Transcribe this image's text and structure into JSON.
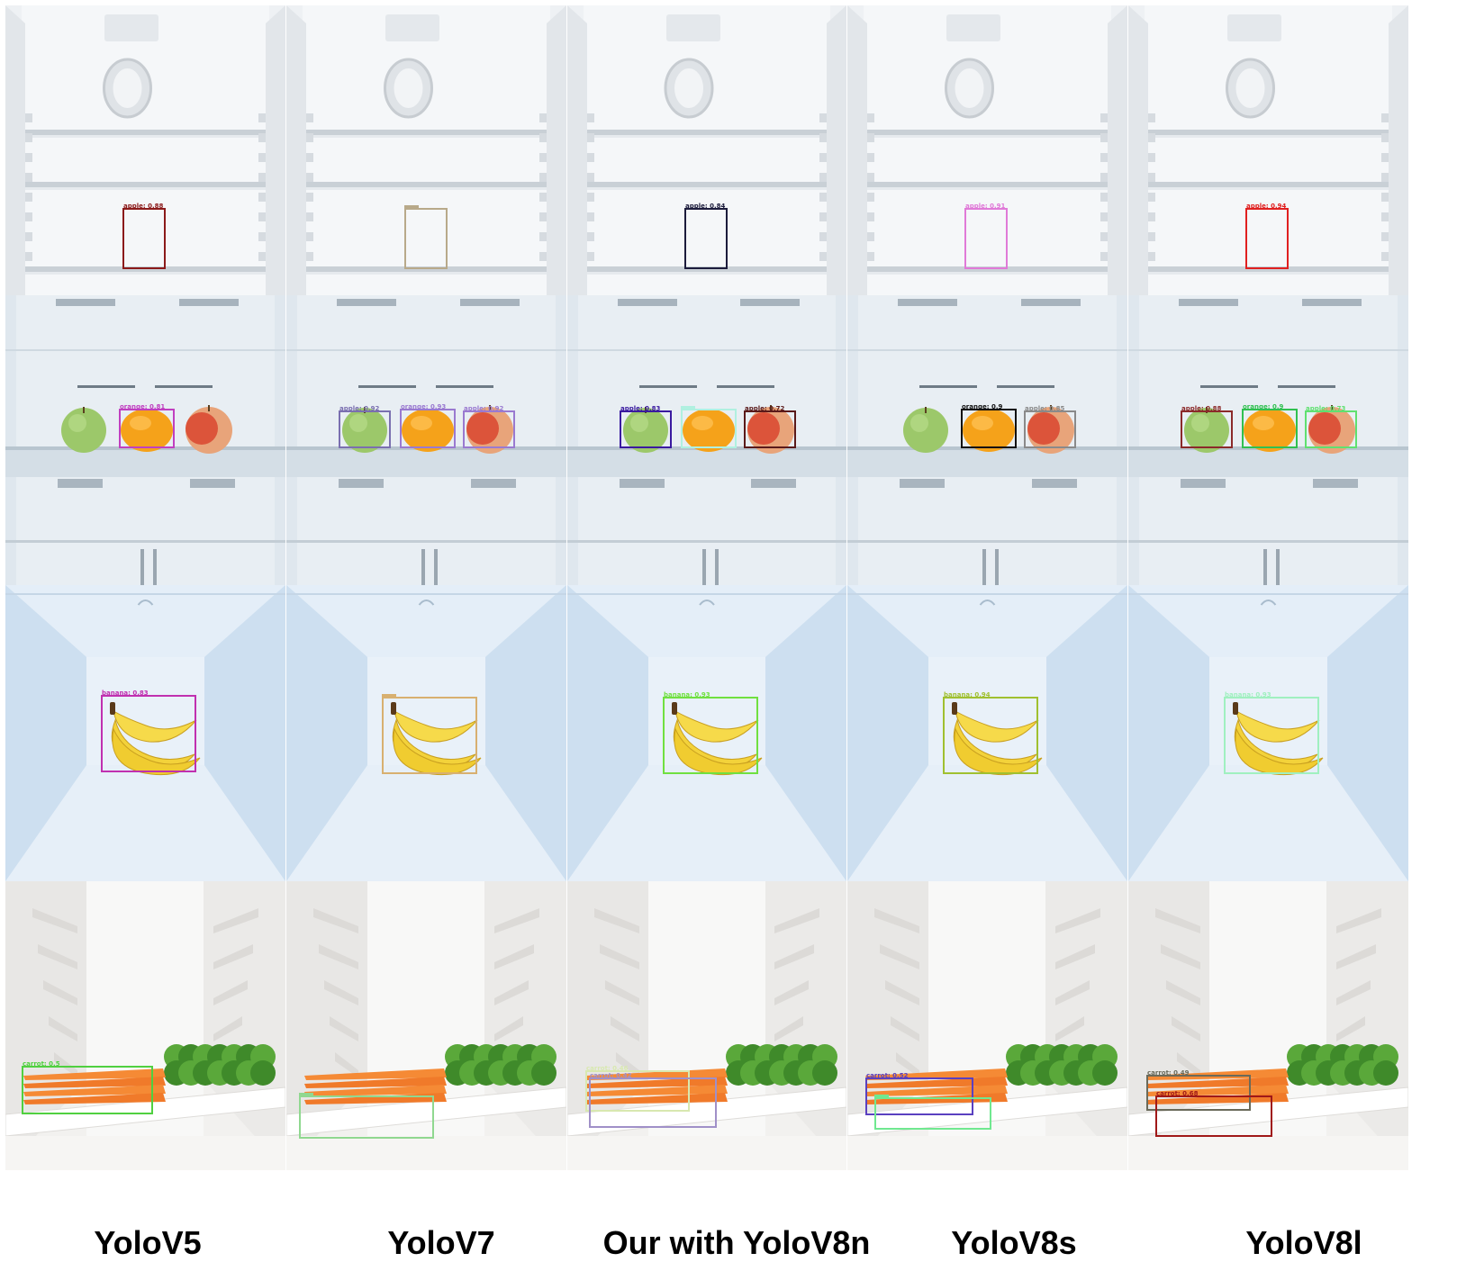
{
  "columns": [
    {
      "caption": "YoloV5"
    },
    {
      "caption": "YoloV7"
    },
    {
      "caption": "Our with YoloV8n"
    },
    {
      "caption": "YoloV8s"
    },
    {
      "caption": "YoloV8l"
    }
  ],
  "rows": [
    {
      "scene": "fridge-shelves",
      "object": "apple",
      "detections": [
        [
          {
            "label": "apple: 0.88",
            "color": "#8b1a1a"
          }
        ],
        [
          {
            "label": "",
            "color": "#b8a98a"
          }
        ],
        [
          {
            "label": "apple: 0.84",
            "color": "#1c1c3c"
          }
        ],
        [
          {
            "label": "apple: 0.91",
            "color": "#e07ad8"
          }
        ],
        [
          {
            "label": "apple: 0.94",
            "color": "#e02020"
          }
        ]
      ]
    },
    {
      "scene": "fridge-glass",
      "object": "three fruits",
      "detections": [
        [
          {
            "label": "orange: 0.81",
            "color": "#c040c0",
            "target": "orange"
          }
        ],
        [
          {
            "label": "apple: 0.92",
            "color": "#7a6fb0",
            "target": "green-apple"
          },
          {
            "label": "orange: 0.93",
            "color": "#9a7ad0",
            "target": "orange"
          },
          {
            "label": "apple: 0.92",
            "color": "#9a7ad0",
            "target": "red-apple"
          }
        ],
        [
          {
            "label": "apple: 0.83",
            "color": "#3a1aa0",
            "target": "green-apple"
          },
          {
            "label": "",
            "color": "#b0f0e0",
            "target": "orange"
          },
          {
            "label": "apple: 0.72",
            "color": "#5a1a1a",
            "target": "red-apple"
          }
        ],
        [
          {
            "label": "orange: 0.9",
            "color": "#101010",
            "target": "orange"
          },
          {
            "label": "apple: 0.85",
            "color": "#8a8a8a",
            "target": "red-apple"
          }
        ],
        [
          {
            "label": "apple: 0.88",
            "color": "#8b2a2a",
            "target": "green-apple"
          },
          {
            "label": "orange: 0.9",
            "color": "#30c050",
            "target": "orange"
          },
          {
            "label": "apple: 0.73",
            "color": "#60e070",
            "target": "red-apple"
          }
        ]
      ]
    },
    {
      "scene": "fridge-blue",
      "object": "banana",
      "detections": [
        [
          {
            "label": "banana: 0.83",
            "color": "#c030b0"
          }
        ],
        [
          {
            "label": "",
            "color": "#d8b070"
          }
        ],
        [
          {
            "label": "banana: 0.93",
            "color": "#70e040"
          }
        ],
        [
          {
            "label": "banana: 0.94",
            "color": "#a0c030"
          }
        ],
        [
          {
            "label": "banana: 0.93",
            "color": "#a0f0c0"
          }
        ]
      ]
    },
    {
      "scene": "fridge-white",
      "object": "carrots",
      "detections": [
        [
          {
            "label": "carrot: 0.5",
            "color": "#50d040",
            "box": "a"
          }
        ],
        [
          {
            "label": "",
            "color": "#90d890",
            "box": "c"
          }
        ],
        [
          {
            "label": "carrot: 0.46",
            "color": "#d8e8b0",
            "box": "d"
          },
          {
            "label": "carrot: 0.42",
            "color": "#a090c8",
            "box": "e"
          }
        ],
        [
          {
            "label": "carrot: 0.52",
            "color": "#5a40c0",
            "box": "f"
          },
          {
            "label": "",
            "color": "#70e890",
            "box": "g"
          }
        ],
        [
          {
            "label": "carrot: 0.49",
            "color": "#6a6a5a",
            "box": "h"
          },
          {
            "label": "carrot: 0.68",
            "color": "#a01818",
            "box": "i"
          }
        ]
      ]
    }
  ]
}
